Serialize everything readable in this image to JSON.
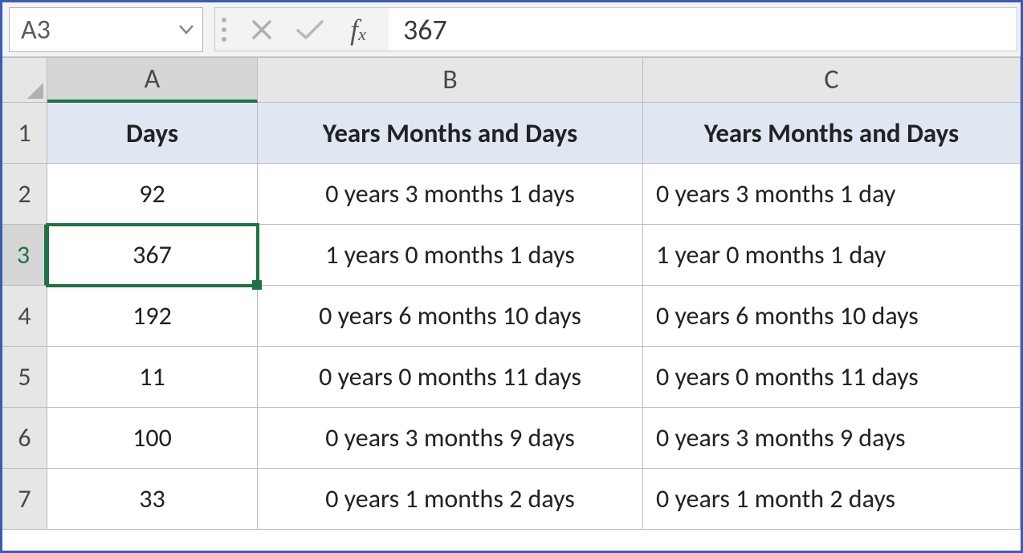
{
  "name_box": "A3",
  "formula_bar_value": "367",
  "columns": [
    "A",
    "B",
    "C"
  ],
  "header_row": {
    "A": "Days",
    "B": "Years Months and Days",
    "C": "Years Months and Days"
  },
  "rows": [
    {
      "n": "2",
      "A": "92",
      "B": "0 years 3 months 1 days",
      "C": "0 years 3 months 1 day"
    },
    {
      "n": "3",
      "A": "367",
      "B": "1 years 0 months 1 days",
      "C": "1 year 0 months 1 day"
    },
    {
      "n": "4",
      "A": "192",
      "B": "0 years 6 months 10 days",
      "C": "0 years 6 months 10 days"
    },
    {
      "n": "5",
      "A": "11",
      "B": "0 years 0 months 11 days",
      "C": "0 years 0 months 11 days"
    },
    {
      "n": "6",
      "A": "100",
      "B": "0 years 3 months 9 days",
      "C": "0 years 3 months 9 days"
    },
    {
      "n": "7",
      "A": "33",
      "B": "0 years 1 months 2 days",
      "C": "0 years 1 month 2 days"
    }
  ],
  "selected_cell": "A3",
  "chart_data": {
    "type": "table",
    "columns": [
      "Days",
      "Years Months and Days",
      "Years Months and Days"
    ],
    "rows": [
      [
        92,
        "0 years 3 months 1 days",
        "0 years 3 months 1 day"
      ],
      [
        367,
        "1 years 0 months 1 days",
        "1 year 0 months 1 day"
      ],
      [
        192,
        "0 years 6 months 10 days",
        "0 years 6 months 10 days"
      ],
      [
        11,
        "0 years 0 months 11 days",
        "0 years 0 months 11 days"
      ],
      [
        100,
        "0 years 3 months 9 days",
        "0 years 3 months 9 days"
      ],
      [
        33,
        "0 years 1 months 2 days",
        "0 years 1 month 2 days"
      ]
    ]
  }
}
